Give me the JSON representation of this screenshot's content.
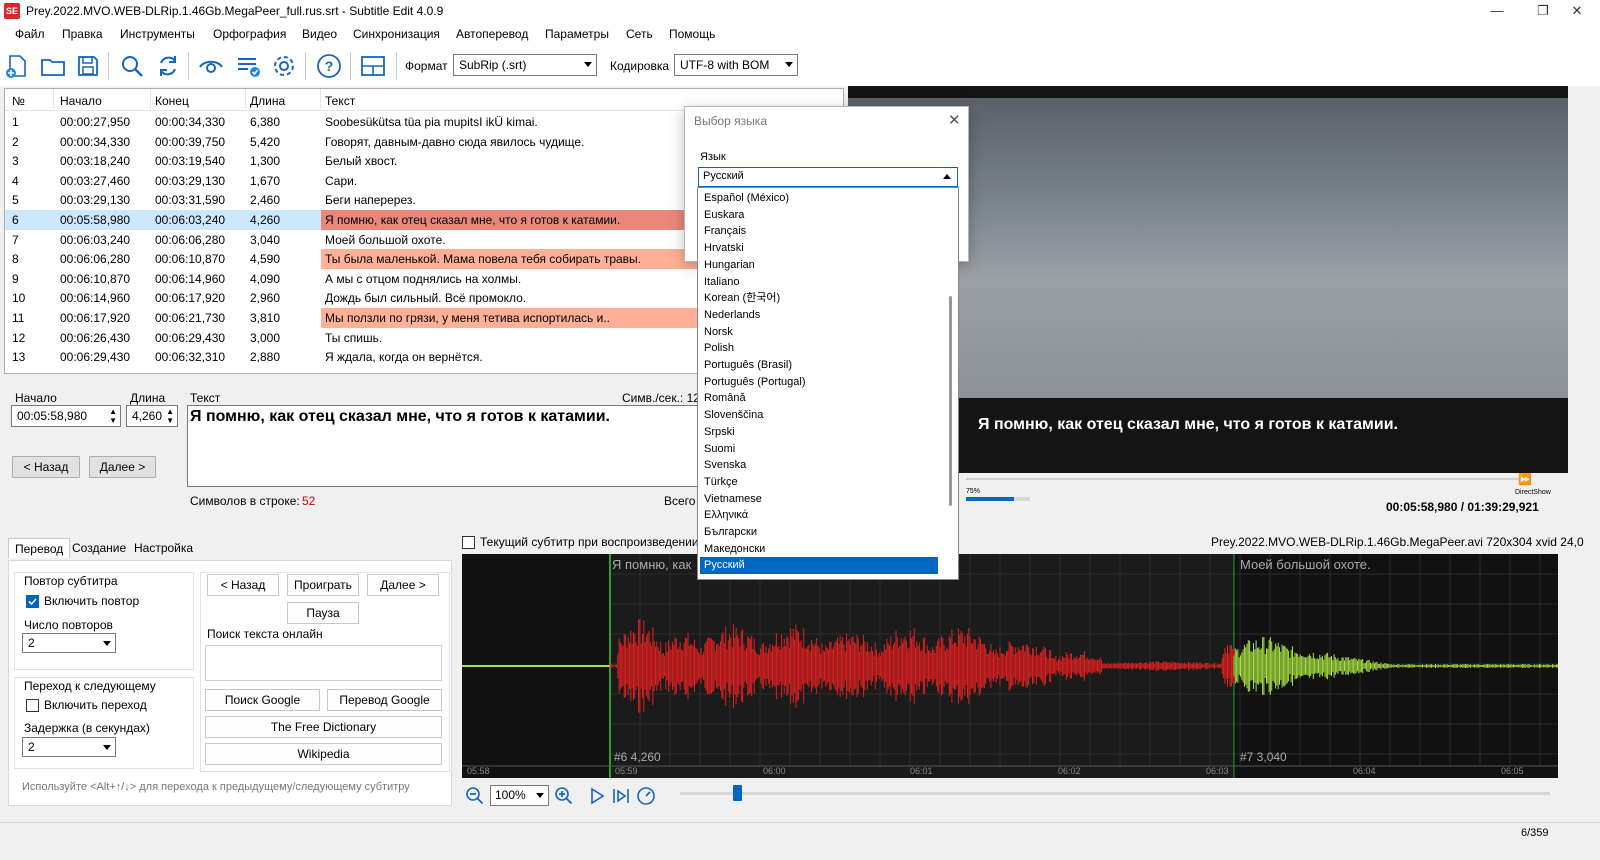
{
  "window": {
    "title": "Prey.2022.MVO.WEB-DLRip.1.46Gb.MegaPeer_full.rus.srt - Subtitle Edit 4.0.9",
    "icon_text": "SE",
    "minimize": "—",
    "maximize": "❐",
    "close": "✕"
  },
  "menu": [
    "Файл",
    "Правка",
    "Инструменты",
    "Орфография",
    "Видео",
    "Синхронизация",
    "Автоперевод",
    "Параметры",
    "Сеть",
    "Помощь"
  ],
  "toolbar": {
    "format_label": "Формат",
    "format_value": "SubRip (.srt)",
    "encoding_label": "Кодировка",
    "encoding_value": "UTF-8 with BOM"
  },
  "grid": {
    "headers": [
      "№",
      "Начало",
      "Конец",
      "Длина",
      "Текст"
    ],
    "rows": [
      {
        "n": "1",
        "start": "00:00:27,950",
        "end": "00:00:34,330",
        "dur": "6,380",
        "text": "Soobesükütsa tüa pia mupitsI ikÜ kimai."
      },
      {
        "n": "2",
        "start": "00:00:34,330",
        "end": "00:00:39,750",
        "dur": "5,420",
        "text": "Говорят, давным-давно сюда явилось чудище."
      },
      {
        "n": "3",
        "start": "00:03:18,240",
        "end": "00:03:19,540",
        "dur": "1,300",
        "text": "Белый хвост."
      },
      {
        "n": "4",
        "start": "00:03:27,460",
        "end": "00:03:29,130",
        "dur": "1,670",
        "text": "Сари."
      },
      {
        "n": "5",
        "start": "00:03:29,130",
        "end": "00:03:31,590",
        "dur": "2,460",
        "text": "Беги наперерез."
      },
      {
        "n": "6",
        "start": "00:05:58,980",
        "end": "00:06:03,240",
        "dur": "4,260",
        "text": "Я помню, как отец сказал мне, что я готов к катамии."
      },
      {
        "n": "7",
        "start": "00:06:03,240",
        "end": "00:06:06,280",
        "dur": "3,040",
        "text": "Моей большой охоте."
      },
      {
        "n": "8",
        "start": "00:06:06,280",
        "end": "00:06:10,870",
        "dur": "4,590",
        "text": "Ты была маленькой. Мама повела тебя собирать травы."
      },
      {
        "n": "9",
        "start": "00:06:10,870",
        "end": "00:06:14,960",
        "dur": "4,090",
        "text": "А мы с отцом поднялись на холмы."
      },
      {
        "n": "10",
        "start": "00:06:14,960",
        "end": "00:06:17,920",
        "dur": "2,960",
        "text": "Дождь был сильный. Всё промокло."
      },
      {
        "n": "11",
        "start": "00:06:17,920",
        "end": "00:06:21,730",
        "dur": "3,810",
        "text": "Мы ползли по грязи, у меня тетива испортилась и.."
      },
      {
        "n": "12",
        "start": "00:06:26,430",
        "end": "00:06:29,430",
        "dur": "3,000",
        "text": "Ты спишь."
      },
      {
        "n": "13",
        "start": "00:06:29,430",
        "end": "00:06:32,310",
        "dur": "2,880",
        "text": "Я ждала, когда он вернётся."
      }
    ]
  },
  "editor": {
    "start_label": "Начало",
    "start_value": "00:05:58,980",
    "duration_label": "Длина",
    "duration_value": "4,260",
    "text_label": "Текст",
    "cps_label": "Симв./сек.: 12",
    "text_value": "Я помню, как отец сказал мне, что я готов к катамии.",
    "prev_button": "< Назад",
    "next_button": "Далее >",
    "chars_label": "Символов в строке:",
    "chars_value": "52",
    "total_label": "Всего"
  },
  "video": {
    "subtitle": "Я помню, как отец сказал мне, что я готов к катамии.",
    "volume": "75%",
    "player": "DirectShow",
    "position": "00:05:58,980 / 01:39:29,921"
  },
  "tabs": [
    "Перевод",
    "Создание",
    "Настройка"
  ],
  "translate_panel": {
    "repeat_group": "Повтор субтитра",
    "enable_repeat": "Включить повтор",
    "repeat_count_label": "Число повторов",
    "repeat_count": "2",
    "next_group": "Переход к следующему",
    "enable_next": "Включить переход",
    "delay_label": "Задержка (в секундах)",
    "delay_value": "2",
    "back": "< Назад",
    "play": "Проиграть",
    "next": "Далее >",
    "pause": "Пауза",
    "search_label": "Поиск текста онлайн",
    "google_search": "Поиск Google",
    "google_translate": "Перевод Google",
    "free_dictionary": "The Free Dictionary",
    "wikipedia": "Wikipedia",
    "hint": "Используйте <Alt+↑/↓> для перехода к предыдущему/следующему субтитру"
  },
  "waveform": {
    "current_sub_label": "Текущий субтитр при воспроизведении",
    "file_info": "Prey.2022.MVO.WEB-DLRip.1.46Gb.MegaPeer.avi 720x304 xvid 24,0",
    "sub1_text": "Я помню, как",
    "sub2_text": "Моей большой охоте.",
    "sub1_tag": "#6  4,260",
    "sub2_tag": "#7  3,040",
    "ticks": [
      "05:58",
      "05:59",
      "06:00",
      "06:01",
      "06:02",
      "06:03",
      "06:04",
      "06:05"
    ],
    "zoom": "100%"
  },
  "dialog": {
    "title": "Выбор языка",
    "language_label": "Язык",
    "selected": "Русский",
    "options": [
      "Español (México)",
      "Euskara",
      "Français",
      "Hrvatski",
      "Hungarian",
      "Italiano",
      "Korean (한국어)",
      "Nederlands",
      "Norsk",
      "Polish",
      "Português (Brasil)",
      "Português (Portugal)",
      "Română",
      "Slovenščina",
      "Srpski",
      "Suomi",
      "Svenska",
      "Türkçe",
      "Vietnamese",
      "Ελληνικά",
      "Български",
      "Македонски",
      "Русский"
    ]
  },
  "status": {
    "counter": "6/359"
  },
  "colors": {
    "accent": "#0067c0",
    "selected_row": "#cce8ff",
    "warn_row": "#ffb096",
    "wave_active": "#e02020",
    "wave_inactive": "#a8e040"
  }
}
